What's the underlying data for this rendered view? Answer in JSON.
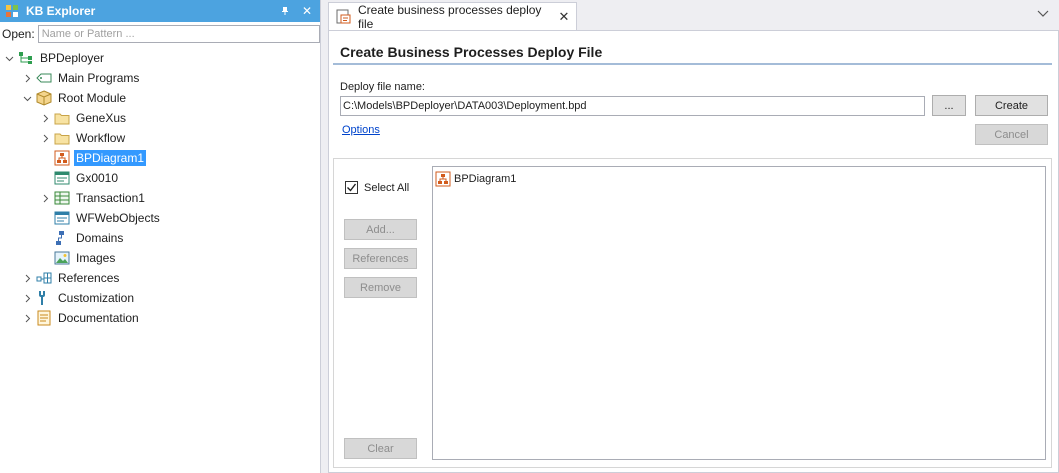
{
  "kb_explorer": {
    "title": "KB Explorer",
    "pin_glyph": "⬖",
    "close_glyph": "✕",
    "open_label": "Open:",
    "open_placeholder": "Name or Pattern ...",
    "tree": {
      "root_label": "BPDeployer",
      "main_programs": "Main Programs",
      "root_module": "Root Module",
      "genexus": "GeneXus",
      "workflow": "Workflow",
      "bpdiagram": "BPDiagram1",
      "gx0010": "Gx0010",
      "transaction1": "Transaction1",
      "wfwebobjects": "WFWebObjects",
      "domains": "Domains",
      "images": "Images",
      "references": "References",
      "customization": "Customization",
      "documentation": "Documentation"
    }
  },
  "tab": {
    "label": "Create business processes deploy file",
    "close_glyph": "✕"
  },
  "dialog": {
    "title": "Create Business Processes Deploy File",
    "file_label": "Deploy file name:",
    "file_value": "C:\\Models\\BPDeployer\\DATA003\\Deployment.bpd",
    "browse_label": "...",
    "create_label": "Create",
    "cancel_label": "Cancel",
    "options_label": "Options",
    "select_all_label": "Select All",
    "select_all_checked": true,
    "add_label": "Add...",
    "references_label": "References",
    "remove_label": "Remove",
    "clear_label": "Clear",
    "items": [
      "BPDiagram1"
    ]
  },
  "colors": {
    "titlebar": "#4ca3e0",
    "selection": "#3399ff",
    "link": "#0044cc",
    "bpdiagram_icon": "#d25b1c"
  }
}
